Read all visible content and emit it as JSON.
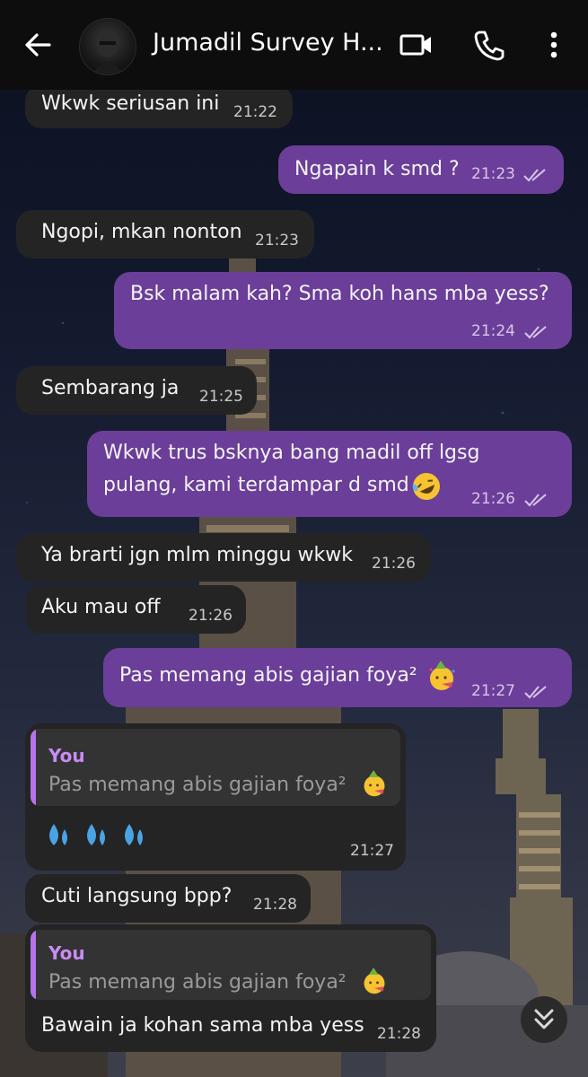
{
  "header": {
    "contact_name": "Jumadil Survey H...",
    "icons": [
      "back-arrow-icon",
      "video-call-icon",
      "phone-icon",
      "more-vert-icon"
    ]
  },
  "messages": [
    {
      "dir": "in",
      "text": "Wkwk seriusan ini",
      "time": "21:22"
    },
    {
      "dir": "out",
      "text": "Ngapain k smd ?",
      "time": "21:23",
      "status": "read"
    },
    {
      "dir": "in",
      "text": "Ngopi, mkan nonton",
      "time": "21:23"
    },
    {
      "dir": "out",
      "text": "Bsk malam kah? Sma koh hans mba yess?",
      "time": "21:24",
      "status": "read"
    },
    {
      "dir": "in",
      "text": "Sembarang ja",
      "time": "21:25"
    },
    {
      "dir": "out",
      "lines": [
        "Wkwk trus bsknya bang madil off lgsg",
        "pulang, kami terdampar d smd"
      ],
      "emoji": "rofl-emoji",
      "time": "21:26",
      "status": "read"
    },
    {
      "dir": "in",
      "text": "Ya brarti jgn mlm minggu wkwk",
      "time": "21:26"
    },
    {
      "dir": "in",
      "text": "Aku mau off",
      "time": "21:26"
    },
    {
      "dir": "out",
      "text": "Pas memang abis gajian foya²",
      "emoji": "partying-face-emoji",
      "time": "21:27",
      "status": "read"
    },
    {
      "dir": "in",
      "quote": {
        "author": "You",
        "text": "Pas memang abis gajian foya²",
        "emoji": "partying-face-emoji"
      },
      "emojis": [
        "sweat-droplets-emoji",
        "sweat-droplets-emoji",
        "sweat-droplets-emoji"
      ],
      "time": "21:27"
    },
    {
      "dir": "in",
      "text": "Cuti langsung bpp?",
      "time": "21:28"
    },
    {
      "dir": "in",
      "quote": {
        "author": "You",
        "text": "Pas memang abis gajian foya²",
        "emoji": "partying-face-emoji"
      },
      "text": "Bawain ja kohan sama mba yess",
      "time": "21:28"
    }
  ],
  "colors": {
    "header_bg": "#0d0d0d",
    "incoming_bubble": "#242424",
    "outgoing_bubble": "#6b3e99",
    "quote_accent": "#b673ea"
  },
  "scroll_button": {
    "icon": "double-chevron-down-icon"
  }
}
